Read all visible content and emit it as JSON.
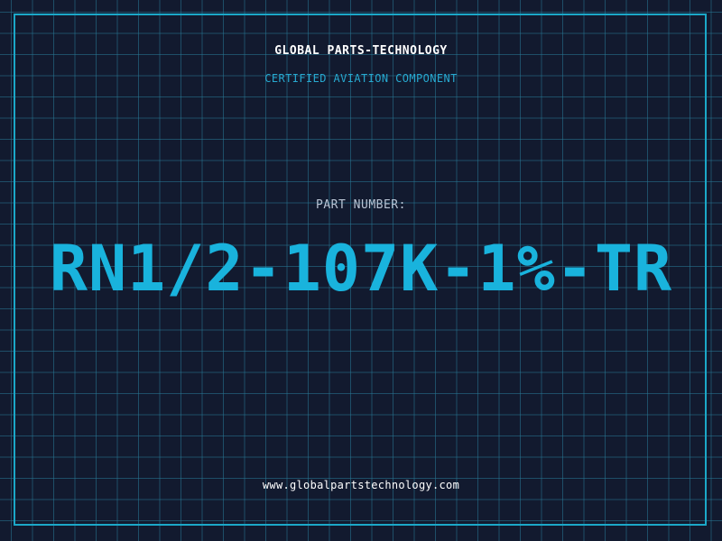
{
  "label": {
    "company": "GLOBAL PARTS-TECHNOLOGY",
    "subtitle": "CERTIFIED AVIATION COMPONENT",
    "part_label": "PART NUMBER:",
    "part_number": "RN1/2-107K-1%-TR",
    "website": "www.globalpartstechnology.com"
  },
  "colors": {
    "background": "#121a2f",
    "grid": "#28789a",
    "border": "#1ba8c8",
    "accent": "#19b3dd",
    "text": "#ffffff",
    "muted": "#b9c4d4"
  }
}
